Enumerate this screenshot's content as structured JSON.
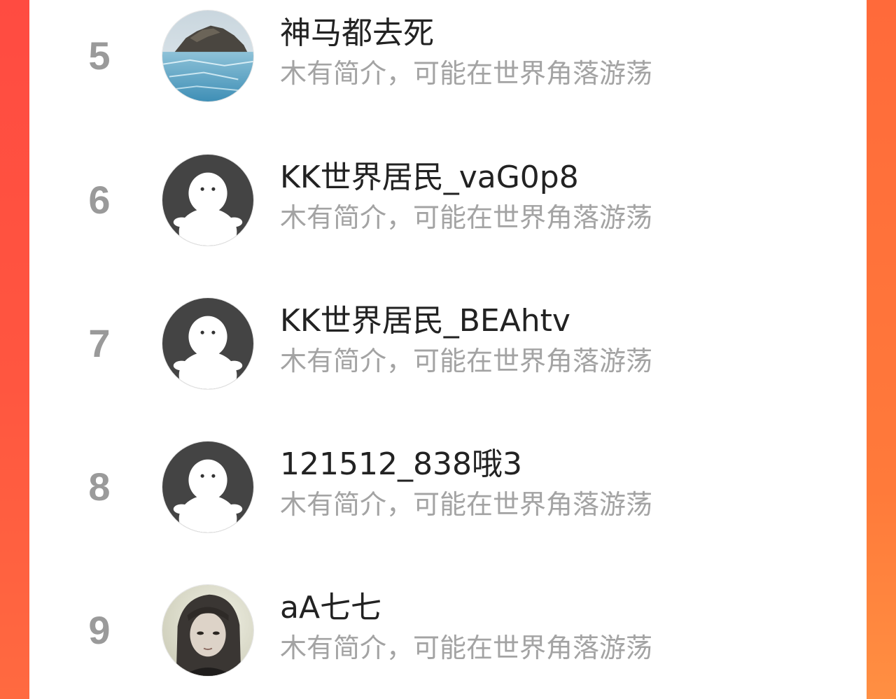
{
  "colors": {
    "accent_left": "#ff4b41",
    "accent_right": "#ff7a3a",
    "rank": "#9a9a9a",
    "name": "#222222",
    "desc": "#a3a3a3",
    "default_avatar": "#444444"
  },
  "rows": [
    {
      "rank": "5",
      "name": "神马都去死",
      "desc": "木有简介，可能在世界角落游荡",
      "avatar": "landscape-photo"
    },
    {
      "rank": "6",
      "name": "KK世界居民_vaG0p8",
      "desc": "木有简介，可能在世界角落游荡",
      "avatar": "default-ghost-icon"
    },
    {
      "rank": "7",
      "name": "KK世界居民_BEAhtv",
      "desc": "木有简介，可能在世界角落游荡",
      "avatar": "default-ghost-icon"
    },
    {
      "rank": "8",
      "name": "121512_838哦3",
      "desc": "木有简介，可能在世界角落游荡",
      "avatar": "default-ghost-icon"
    },
    {
      "rank": "9",
      "name": "aA七七",
      "desc": "木有简介，可能在世界角落游荡",
      "avatar": "portrait-photo"
    }
  ]
}
